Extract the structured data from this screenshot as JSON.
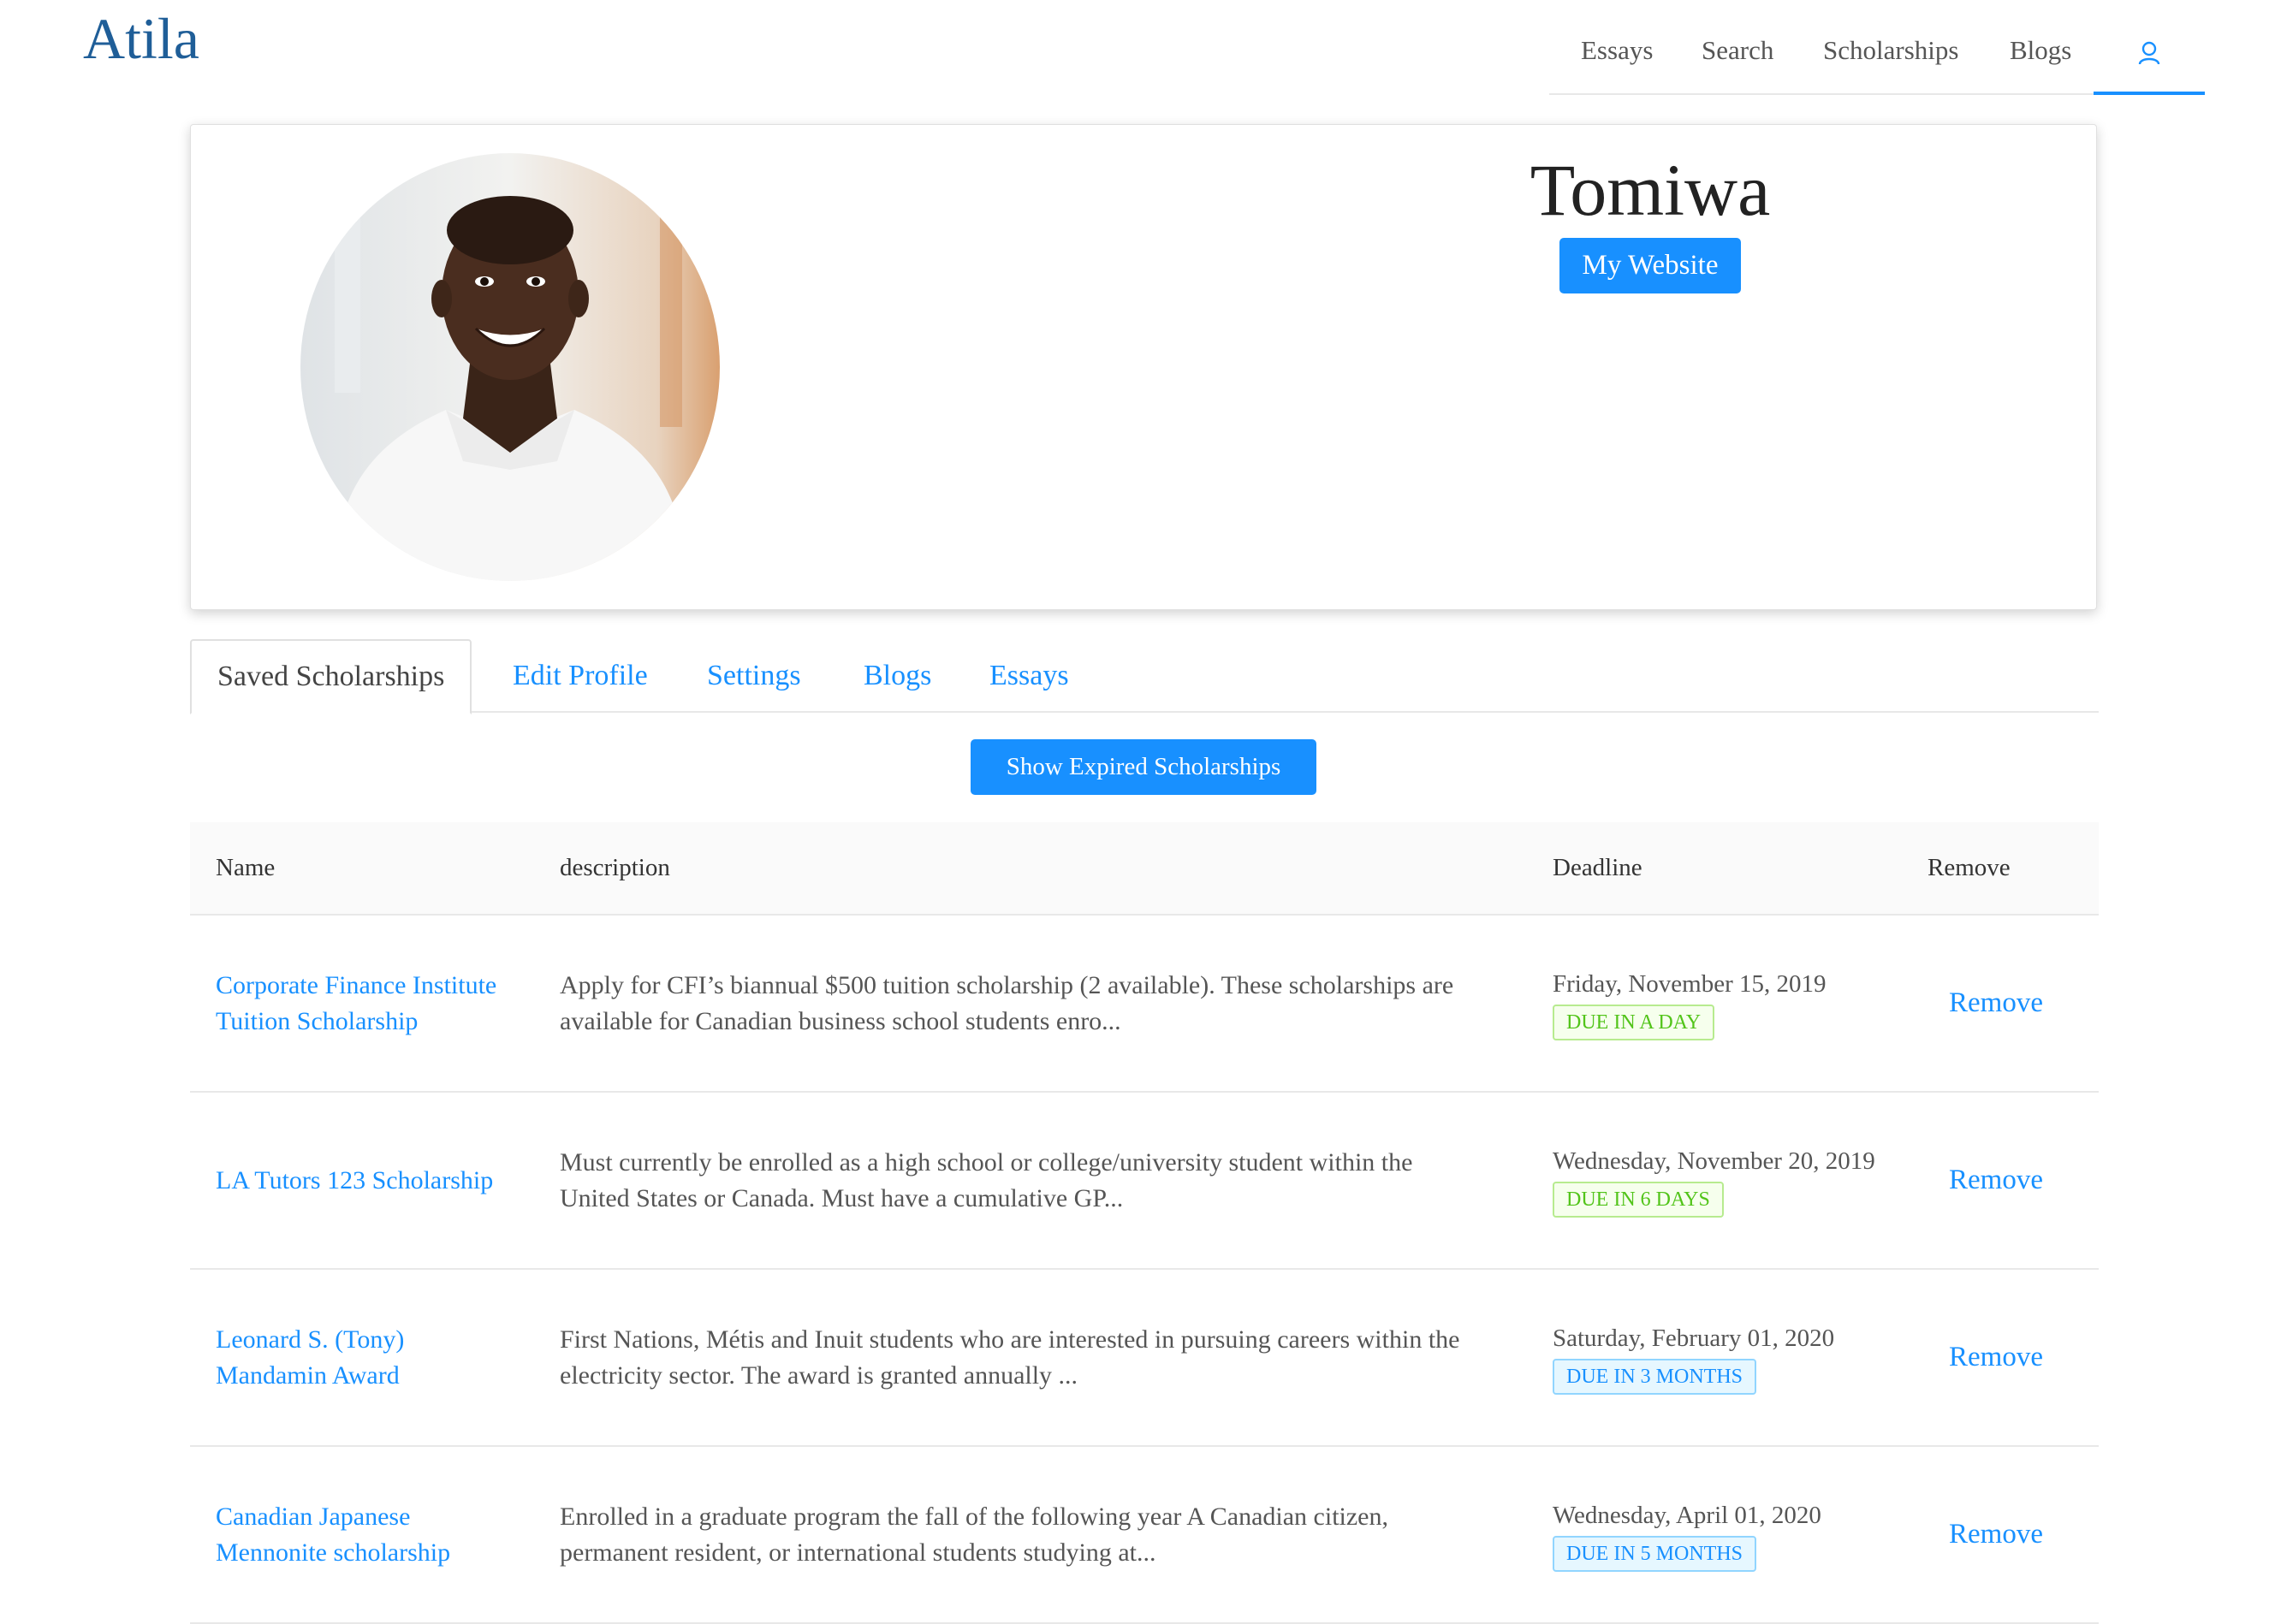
{
  "header": {
    "logo": "Atila",
    "nav": [
      {
        "label": "Essays"
      },
      {
        "label": "Search"
      },
      {
        "label": "Scholarships"
      },
      {
        "label": "Blogs"
      }
    ],
    "user_icon": "user-icon"
  },
  "profile": {
    "name": "Tomiwa",
    "website_button": "My Website",
    "avatar": "profile-photo"
  },
  "tabs": [
    {
      "label": "Saved Scholarships",
      "active": true
    },
    {
      "label": "Edit Profile"
    },
    {
      "label": "Settings"
    },
    {
      "label": "Blogs"
    },
    {
      "label": "Essays"
    }
  ],
  "show_expired_label": "Show Expired Scholarships",
  "table": {
    "columns": {
      "name": "Name",
      "description": "description",
      "deadline": "Deadline",
      "remove": "Remove"
    },
    "rows": [
      {
        "name": "Corporate Finance Institute Tuition Scholarship",
        "description": "Apply for CFI’s biannual $500 tuition scholarship (2 available). These scholarships are available for Canadian business school students enro...",
        "deadline": "Friday, November 15, 2019",
        "badge": "DUE IN A DAY",
        "badge_color": "green",
        "remove": "Remove"
      },
      {
        "name": "LA Tutors 123 Scholarship",
        "description": "Must currently be enrolled as a high school or college/university student within the United States or Canada. Must have a cumulative GP...",
        "deadline": "Wednesday, November 20, 2019",
        "badge": "DUE IN 6 DAYS",
        "badge_color": "green",
        "remove": "Remove"
      },
      {
        "name": "Leonard S. (Tony) Mandamin Award",
        "description": "First Nations, Métis and Inuit students who are interested in pursuing careers within the electricity sector. The award is granted annually ...",
        "deadline": "Saturday, February 01, 2020",
        "badge": "DUE IN 3 MONTHS",
        "badge_color": "blue",
        "remove": "Remove"
      },
      {
        "name": "Canadian Japanese Mennonite scholarship",
        "description": "Enrolled in a graduate program the fall of the following year A Canadian citizen, permanent resident, or international students studying at...",
        "deadline": "Wednesday, April 01, 2020",
        "badge": "DUE IN 5 MONTHS",
        "badge_color": "blue",
        "remove": "Remove"
      }
    ]
  },
  "colors": {
    "primary": "#1890ff",
    "logo": "#1f5e98",
    "badge_green": "#52c41a",
    "badge_blue": "#1890ff"
  }
}
